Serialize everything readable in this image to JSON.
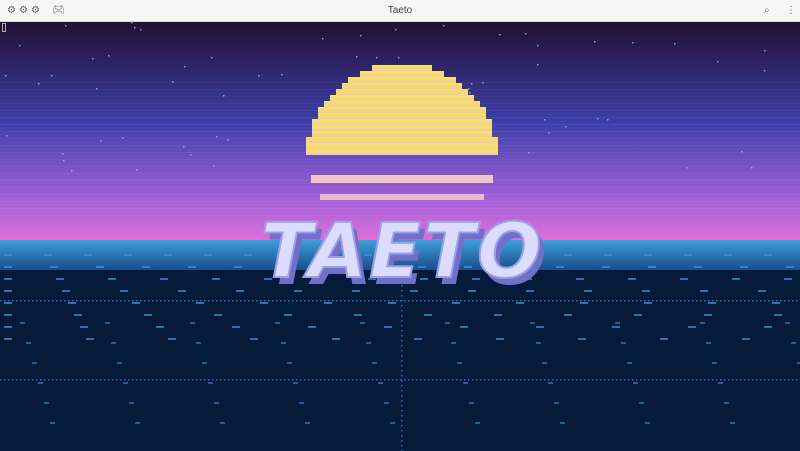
{
  "window": {
    "title": "Taeto",
    "left_icons": [
      "settings-icon",
      "settings-icon",
      "settings-icon",
      "gamepad-icon"
    ],
    "right_icons": [
      "search-icon",
      "more-vertical-icon"
    ]
  },
  "game": {
    "logo_text": "TAETO"
  },
  "colors": {
    "sky_top": "#241034",
    "sky_mid": "#3c3fa8",
    "sky_bottom": "#e070d8",
    "sun_top": "#f8e840",
    "sun_bottom": "#f0c8c0",
    "sea": "#2c8cc8",
    "ground": "#061a3a",
    "grid_dots": "#2070b8",
    "logo_face": "#dcdcff",
    "logo_shadow": "#7070c8"
  }
}
